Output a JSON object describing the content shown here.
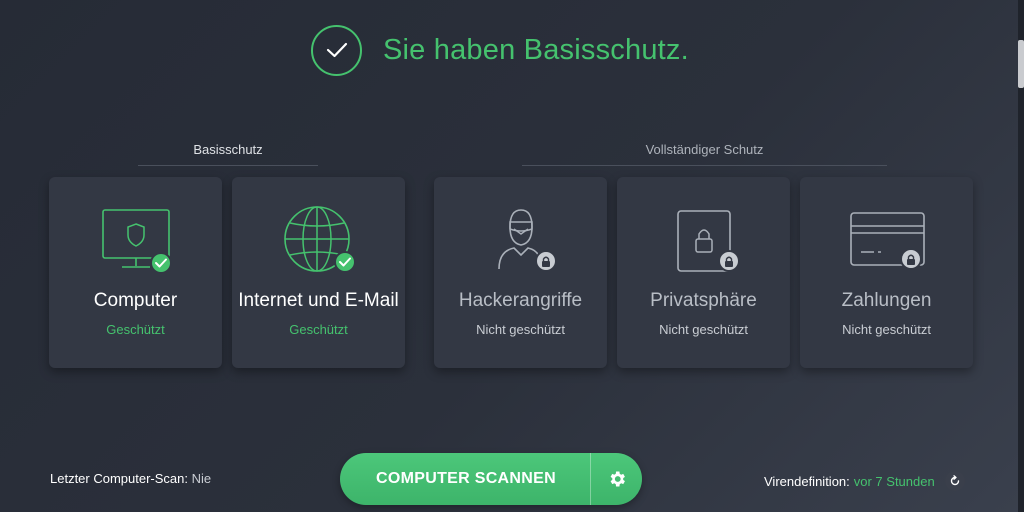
{
  "header": {
    "title": "Sie haben Basisschutz."
  },
  "sections": {
    "basic_label": "Basisschutz",
    "full_label": "Vollständiger Schutz"
  },
  "cards": [
    {
      "title": "Computer",
      "status": "Geschützt",
      "icon": "monitor-shield-icon",
      "protected": true
    },
    {
      "title": "Internet und E-Mail",
      "status": "Geschützt",
      "icon": "globe-icon",
      "protected": true
    },
    {
      "title": "Hackerangriffe",
      "status": "Nicht geschützt",
      "icon": "hacker-icon",
      "protected": false
    },
    {
      "title": "Privatsphäre",
      "status": "Nicht geschützt",
      "icon": "padlock-icon",
      "protected": false
    },
    {
      "title": "Zahlungen",
      "status": "Nicht geschützt",
      "icon": "credit-card-icon",
      "protected": false
    }
  ],
  "footer": {
    "last_scan_label": "Letzter Computer-Scan:",
    "last_scan_value": "Nie",
    "scan_button_label": "COMPUTER SCANNEN",
    "virus_def_label": "Virendefinition:",
    "virus_def_value": "vor 7 Stunden"
  },
  "colors": {
    "accent_green": "#45c26e",
    "background": "#2b303b",
    "card": "#333844"
  }
}
